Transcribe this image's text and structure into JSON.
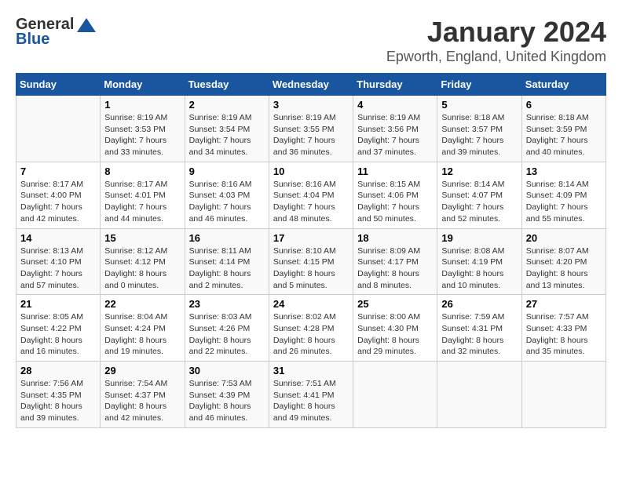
{
  "header": {
    "logo_general": "General",
    "logo_blue": "Blue",
    "title": "January 2024",
    "subtitle": "Epworth, England, United Kingdom"
  },
  "days_of_week": [
    "Sunday",
    "Monday",
    "Tuesday",
    "Wednesday",
    "Thursday",
    "Friday",
    "Saturday"
  ],
  "weeks": [
    [
      {
        "day": "",
        "info": ""
      },
      {
        "day": "1",
        "info": "Sunrise: 8:19 AM\nSunset: 3:53 PM\nDaylight: 7 hours\nand 33 minutes."
      },
      {
        "day": "2",
        "info": "Sunrise: 8:19 AM\nSunset: 3:54 PM\nDaylight: 7 hours\nand 34 minutes."
      },
      {
        "day": "3",
        "info": "Sunrise: 8:19 AM\nSunset: 3:55 PM\nDaylight: 7 hours\nand 36 minutes."
      },
      {
        "day": "4",
        "info": "Sunrise: 8:19 AM\nSunset: 3:56 PM\nDaylight: 7 hours\nand 37 minutes."
      },
      {
        "day": "5",
        "info": "Sunrise: 8:18 AM\nSunset: 3:57 PM\nDaylight: 7 hours\nand 39 minutes."
      },
      {
        "day": "6",
        "info": "Sunrise: 8:18 AM\nSunset: 3:59 PM\nDaylight: 7 hours\nand 40 minutes."
      }
    ],
    [
      {
        "day": "7",
        "info": "Sunrise: 8:17 AM\nSunset: 4:00 PM\nDaylight: 7 hours\nand 42 minutes."
      },
      {
        "day": "8",
        "info": "Sunrise: 8:17 AM\nSunset: 4:01 PM\nDaylight: 7 hours\nand 44 minutes."
      },
      {
        "day": "9",
        "info": "Sunrise: 8:16 AM\nSunset: 4:03 PM\nDaylight: 7 hours\nand 46 minutes."
      },
      {
        "day": "10",
        "info": "Sunrise: 8:16 AM\nSunset: 4:04 PM\nDaylight: 7 hours\nand 48 minutes."
      },
      {
        "day": "11",
        "info": "Sunrise: 8:15 AM\nSunset: 4:06 PM\nDaylight: 7 hours\nand 50 minutes."
      },
      {
        "day": "12",
        "info": "Sunrise: 8:14 AM\nSunset: 4:07 PM\nDaylight: 7 hours\nand 52 minutes."
      },
      {
        "day": "13",
        "info": "Sunrise: 8:14 AM\nSunset: 4:09 PM\nDaylight: 7 hours\nand 55 minutes."
      }
    ],
    [
      {
        "day": "14",
        "info": "Sunrise: 8:13 AM\nSunset: 4:10 PM\nDaylight: 7 hours\nand 57 minutes."
      },
      {
        "day": "15",
        "info": "Sunrise: 8:12 AM\nSunset: 4:12 PM\nDaylight: 8 hours\nand 0 minutes."
      },
      {
        "day": "16",
        "info": "Sunrise: 8:11 AM\nSunset: 4:14 PM\nDaylight: 8 hours\nand 2 minutes."
      },
      {
        "day": "17",
        "info": "Sunrise: 8:10 AM\nSunset: 4:15 PM\nDaylight: 8 hours\nand 5 minutes."
      },
      {
        "day": "18",
        "info": "Sunrise: 8:09 AM\nSunset: 4:17 PM\nDaylight: 8 hours\nand 8 minutes."
      },
      {
        "day": "19",
        "info": "Sunrise: 8:08 AM\nSunset: 4:19 PM\nDaylight: 8 hours\nand 10 minutes."
      },
      {
        "day": "20",
        "info": "Sunrise: 8:07 AM\nSunset: 4:20 PM\nDaylight: 8 hours\nand 13 minutes."
      }
    ],
    [
      {
        "day": "21",
        "info": "Sunrise: 8:05 AM\nSunset: 4:22 PM\nDaylight: 8 hours\nand 16 minutes."
      },
      {
        "day": "22",
        "info": "Sunrise: 8:04 AM\nSunset: 4:24 PM\nDaylight: 8 hours\nand 19 minutes."
      },
      {
        "day": "23",
        "info": "Sunrise: 8:03 AM\nSunset: 4:26 PM\nDaylight: 8 hours\nand 22 minutes."
      },
      {
        "day": "24",
        "info": "Sunrise: 8:02 AM\nSunset: 4:28 PM\nDaylight: 8 hours\nand 26 minutes."
      },
      {
        "day": "25",
        "info": "Sunrise: 8:00 AM\nSunset: 4:30 PM\nDaylight: 8 hours\nand 29 minutes."
      },
      {
        "day": "26",
        "info": "Sunrise: 7:59 AM\nSunset: 4:31 PM\nDaylight: 8 hours\nand 32 minutes."
      },
      {
        "day": "27",
        "info": "Sunrise: 7:57 AM\nSunset: 4:33 PM\nDaylight: 8 hours\nand 35 minutes."
      }
    ],
    [
      {
        "day": "28",
        "info": "Sunrise: 7:56 AM\nSunset: 4:35 PM\nDaylight: 8 hours\nand 39 minutes."
      },
      {
        "day": "29",
        "info": "Sunrise: 7:54 AM\nSunset: 4:37 PM\nDaylight: 8 hours\nand 42 minutes."
      },
      {
        "day": "30",
        "info": "Sunrise: 7:53 AM\nSunset: 4:39 PM\nDaylight: 8 hours\nand 46 minutes."
      },
      {
        "day": "31",
        "info": "Sunrise: 7:51 AM\nSunset: 4:41 PM\nDaylight: 8 hours\nand 49 minutes."
      },
      {
        "day": "",
        "info": ""
      },
      {
        "day": "",
        "info": ""
      },
      {
        "day": "",
        "info": ""
      }
    ]
  ]
}
